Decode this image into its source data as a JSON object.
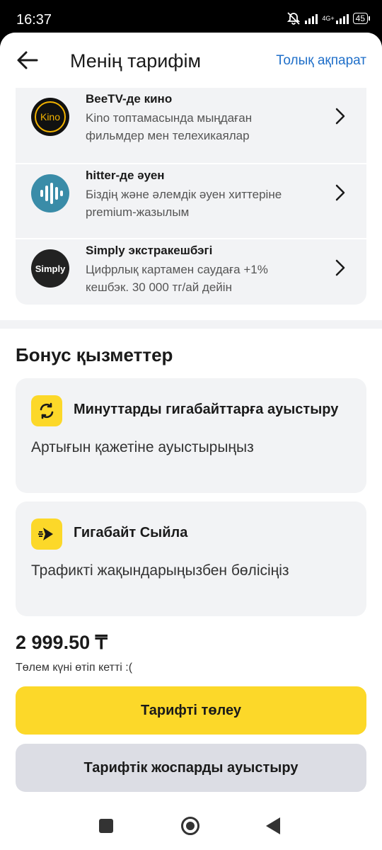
{
  "status": {
    "time": "16:37",
    "network": "4G+",
    "battery": "45"
  },
  "header": {
    "title": "Менің тарифім",
    "info_link": "Толық ақпарат"
  },
  "services": [
    {
      "name": "BeeTV-де кино",
      "desc": "Kino топтамасында мыңдаған фильмдер мен телехикаялар",
      "logo_text": "Kino"
    },
    {
      "name": "hitter-де әуен",
      "desc": "Біздің және әлемдік әуен хиттеріне premium-жазылым"
    },
    {
      "name": "Simply экстракешбэгі",
      "desc": "Цифрлық картамен саудаға +1% кешбэк. 30 000 тг/ай дейін",
      "logo_text": "Simply"
    }
  ],
  "bonus": {
    "title": "Бонус қызметтер",
    "items": [
      {
        "name": "Минуттарды гигабайттарға ауыстыру",
        "desc": "Артығын қажетіне ауыстырыңыз",
        "icon": "swap-icon"
      },
      {
        "name": "Гигабайт Сыйла",
        "desc": "Трафикті жақындарыңызбен бөлісіңіз",
        "icon": "send-icon"
      }
    ]
  },
  "payment": {
    "price": "2 999.50 ₸",
    "note": "Төлем күні өтіп кетті :("
  },
  "buttons": {
    "pay": "Тарифті төлеу",
    "change": "Тарифтік жоспарды ауыстыру"
  },
  "colors": {
    "accent": "#fcd829",
    "link": "#1f6fc9",
    "card_bg": "#f2f3f5",
    "secondary_btn": "#dcdde4"
  }
}
